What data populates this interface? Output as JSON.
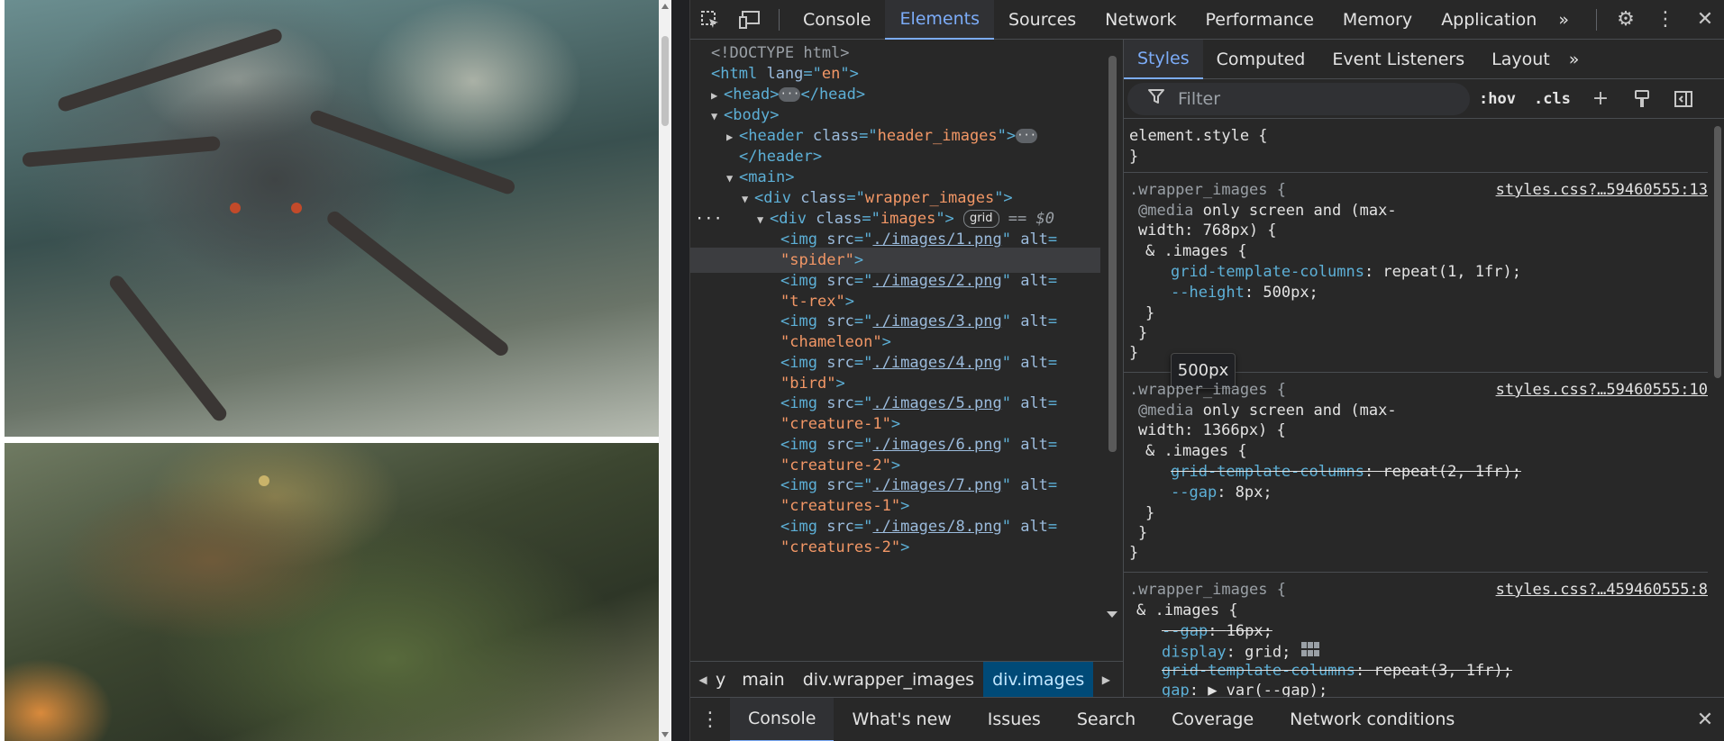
{
  "page": {
    "images": [
      {
        "alt": "spider"
      },
      {
        "alt": "t-rex"
      }
    ]
  },
  "devtools": {
    "toolbar": {
      "tabs": [
        "Console",
        "Elements",
        "Sources",
        "Network",
        "Performance",
        "Memory",
        "Application"
      ],
      "active_tab": "Elements",
      "more": "»",
      "icons": [
        "inspect-icon",
        "device-toggle-icon",
        "settings-icon",
        "more-vert-icon",
        "close-icon"
      ]
    },
    "elements": {
      "doctype": "<!DOCTYPE html>",
      "html_open": {
        "tag": "html",
        "attr": "lang",
        "value": "en"
      },
      "head": {
        "tag": "head"
      },
      "body": {
        "tag": "body"
      },
      "header": {
        "tag": "header",
        "attr": "class",
        "value": "header_images"
      },
      "main": {
        "tag": "main"
      },
      "wrapper": {
        "tag": "div",
        "attr": "class",
        "value": "wrapper_images"
      },
      "images_div": {
        "tag": "div",
        "attr": "class",
        "value": "images",
        "badge": "grid",
        "marker": "== $0"
      },
      "imgs": [
        {
          "src": "./images/1.png",
          "alt": "spider"
        },
        {
          "src": "./images/2.png",
          "alt": "t-rex"
        },
        {
          "src": "./images/3.png",
          "alt": "chameleon"
        },
        {
          "src": "./images/4.png",
          "alt": "bird"
        },
        {
          "src": "./images/5.png",
          "alt": "creature-1"
        },
        {
          "src": "./images/6.png",
          "alt": "creature-2"
        },
        {
          "src": "./images/7.png",
          "alt": "creatures-1"
        },
        {
          "src": "./images/8.png",
          "alt": "creatures-2"
        }
      ]
    },
    "breadcrumb": [
      "y",
      "main",
      "div.wrapper_images",
      "div.images"
    ],
    "styles": {
      "tabs": [
        "Styles",
        "Computed",
        "Event Listeners",
        "Layout"
      ],
      "active_tab": "Styles",
      "more": "»",
      "filter_placeholder": "Filter",
      "buttons": [
        ":hov",
        ".cls"
      ],
      "element_style": "element.style {",
      "close_brace": "}",
      "tooltip": "500px",
      "rules": [
        {
          "selector": ".wrapper_images {",
          "source": "styles.css?…59460555:13",
          "media_1": "@media",
          "media_2": " only screen and (max-",
          "media_3": "width: 768px) {",
          "nested": "& .images {",
          "decls": [
            {
              "prop": "grid-template-columns",
              "value": "repeat(1, 1fr);",
              "struck": false
            },
            {
              "prop": "--height",
              "value": "500px;",
              "struck": false
            }
          ]
        },
        {
          "selector": ".wrapper_images {",
          "source": "styles.css?…59460555:10",
          "media_1": "@media",
          "media_2": " only screen and (max-",
          "media_3": "width: 1366px) {",
          "nested": "& .images {",
          "decls": [
            {
              "prop": "grid-template-columns",
              "value": "repeat(2, 1fr);",
              "struck": true
            },
            {
              "prop": "--gap",
              "value": "8px;",
              "struck": false
            }
          ]
        },
        {
          "selector": ".wrapper_images {",
          "source": "styles.css?…459460555:8",
          "nested": "& .images {",
          "decls": [
            {
              "prop": "--gap",
              "value": "16px;",
              "struck": true
            },
            {
              "prop": "display",
              "value": "grid;",
              "struck": false
            },
            {
              "prop": "grid-template-columns",
              "value": "repeat(3, 1fr);",
              "struck": true
            },
            {
              "prop": "gap",
              "value": "▶ var(--gap);",
              "struck": false
            }
          ]
        }
      ]
    },
    "drawer": {
      "tabs": [
        "Console",
        "What's new",
        "Issues",
        "Search",
        "Coverage",
        "Network conditions"
      ],
      "active_tab": "Console"
    }
  }
}
